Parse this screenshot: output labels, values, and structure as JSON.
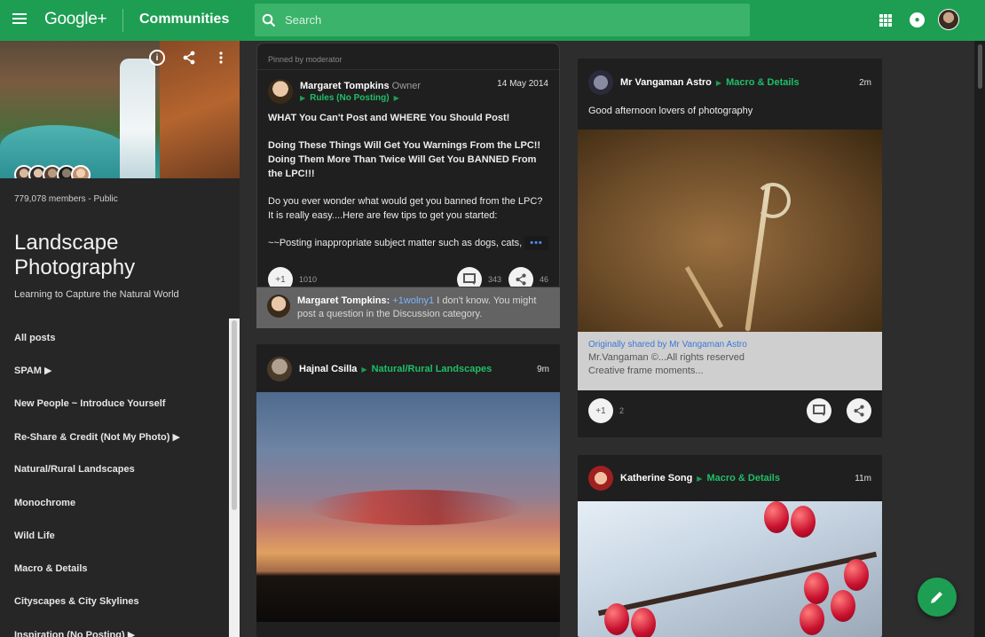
{
  "topbar": {
    "logo": "Google+",
    "section": "Communities",
    "search_placeholder": "Search"
  },
  "community": {
    "members": "779,078 members - Public",
    "name": "Landscape Photography",
    "tagline": "Learning to Capture the Natural World"
  },
  "nav": {
    "items": [
      {
        "label": "All posts"
      },
      {
        "label": "SPAM ▶"
      },
      {
        "label": "New People ~ Introduce Yourself"
      },
      {
        "label": "Re-Share & Credit (Not My Photo) ▶"
      },
      {
        "label": "Natural/Rural Landscapes"
      },
      {
        "label": "Monochrome"
      },
      {
        "label": "Wild Life"
      },
      {
        "label": "Macro & Details"
      },
      {
        "label": "Cityscapes & City Skylines"
      },
      {
        "label": "Inspiration (No Posting) ▶"
      }
    ]
  },
  "pinned": {
    "label": "Pinned by moderator",
    "author": "Margaret Tompkins",
    "role": "Owner",
    "category": "Rules (No Posting)",
    "date": "14 May 2014",
    "line1": "WHAT You Can't Post and WHERE You Should Post!",
    "line2": "Doing These Things Will Get You Warnings From the LPC!! Doing Them More Than Twice Will Get You BANNED From the LPC!!!",
    "line3": "Do you ever wonder what would get you banned from the LPC? It is really easy....Here are few tips to get you started:",
    "line4": "~~Posting inappropriate subject matter such as dogs, cats,",
    "more": "•••",
    "plus_label": "+1",
    "plus_count": "1010",
    "comment_count": "343",
    "share_count": "46"
  },
  "comment": {
    "author": "Margaret Tompkins:",
    "mention": "+1wolny1",
    "text": " I don't know.  You might post a question in the Discussion category."
  },
  "hajnal": {
    "author": "Hajnal Csilla",
    "category": "Natural/Rural Landscapes",
    "time": "9m"
  },
  "astro": {
    "author": "Mr Vangaman Astro",
    "category": "Macro & Details",
    "time": "2m",
    "text": "Good afternoon lovers of photography",
    "shared_by": "Originally shared by Mr Vangaman Astro",
    "shared_line1": "Mr.Vangaman ©...All rights reserved",
    "shared_line2": "Creative frame moments...",
    "plus_label": "+1",
    "plus_count": "2"
  },
  "katherine": {
    "author": "Katherine Song",
    "category": "Macro & Details",
    "time": "11m"
  },
  "icons": {
    "menu": "menu-icon",
    "search": "search-icon",
    "apps": "apps-icon",
    "notifications": "bell-icon",
    "info": "info-icon",
    "share": "share-icon",
    "more": "more-vert-icon",
    "comment": "comment-icon",
    "edit": "pencil-icon"
  },
  "colors": {
    "brand_green": "#1e9e53",
    "category_green": "#1fbf66",
    "card_bg": "#1f1f1f",
    "page_bg": "#2d2d2d"
  }
}
